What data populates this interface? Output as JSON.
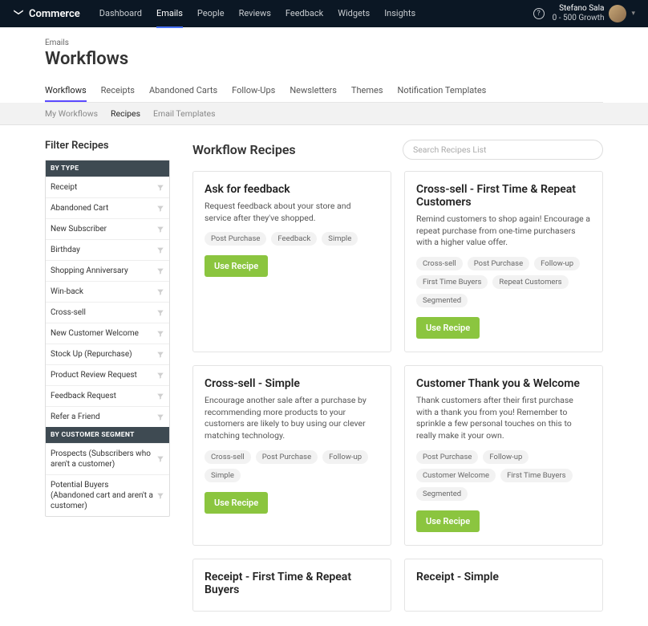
{
  "brand": "Commerce",
  "nav": [
    "Dashboard",
    "Emails",
    "People",
    "Reviews",
    "Feedback",
    "Widgets",
    "Insights"
  ],
  "nav_active": 1,
  "user": {
    "name": "Stefano Sala",
    "plan": "0 - 500 Growth"
  },
  "breadcrumb": "Emails",
  "page_title": "Workflows",
  "tabs": [
    "Workflows",
    "Receipts",
    "Abandoned Carts",
    "Follow-Ups",
    "Newsletters",
    "Themes",
    "Notification Templates"
  ],
  "tabs_active": 0,
  "subtabs": [
    "My Workflows",
    "Recipes",
    "Email Templates"
  ],
  "subtabs_active": 1,
  "filter_title": "Filter Recipes",
  "filters": {
    "by_type_head": "BY TYPE",
    "by_type": [
      "Receipt",
      "Abandoned Cart",
      "New Subscriber",
      "Birthday",
      "Shopping Anniversary",
      "Win-back",
      "Cross-sell",
      "New Customer Welcome",
      "Stock Up (Repurchase)",
      "Product Review Request",
      "Feedback Request",
      "Refer a Friend"
    ],
    "by_seg_head": "BY CUSTOMER SEGMENT",
    "by_seg": [
      "Prospects (Subscribers who aren't a customer)",
      "Potential Buyers (Abandoned cart and aren't a customer)"
    ]
  },
  "content_title": "Workflow Recipes",
  "search_placeholder": "Search Recipes List",
  "use_recipe_label": "Use Recipe",
  "cards": [
    {
      "title": "Ask for feedback",
      "desc": "Request feedback about your store and service after they've shopped.",
      "tags": [
        "Post Purchase",
        "Feedback",
        "Simple"
      ]
    },
    {
      "title": "Cross-sell - First Time & Repeat Customers",
      "desc": "Remind customers to shop again! Encourage a repeat purchase from one-time purchasers with a higher value offer.",
      "tags": [
        "Cross-sell",
        "Post Purchase",
        "Follow-up",
        "First Time Buyers",
        "Repeat Customers",
        "Segmented"
      ]
    },
    {
      "title": "Cross-sell - Simple",
      "desc": "Encourage another sale after a purchase by recommending more products to your customers are likely to buy using our clever matching technology.",
      "tags": [
        "Cross-sell",
        "Post Purchase",
        "Follow-up",
        "Simple"
      ]
    },
    {
      "title": "Customer Thank you & Welcome",
      "desc": "Thank customers after their first purchase with a thank you from you! Remember to sprinkle a few personal touches on this to really make it your own.",
      "tags": [
        "Post Purchase",
        "Follow-up",
        "Customer Welcome",
        "First Time Buyers",
        "Segmented"
      ]
    },
    {
      "title": "Receipt - First Time & Repeat Buyers",
      "desc": "",
      "tags": [],
      "trunc": true
    },
    {
      "title": "Receipt - Simple",
      "desc": "",
      "tags": [],
      "trunc": true
    }
  ]
}
